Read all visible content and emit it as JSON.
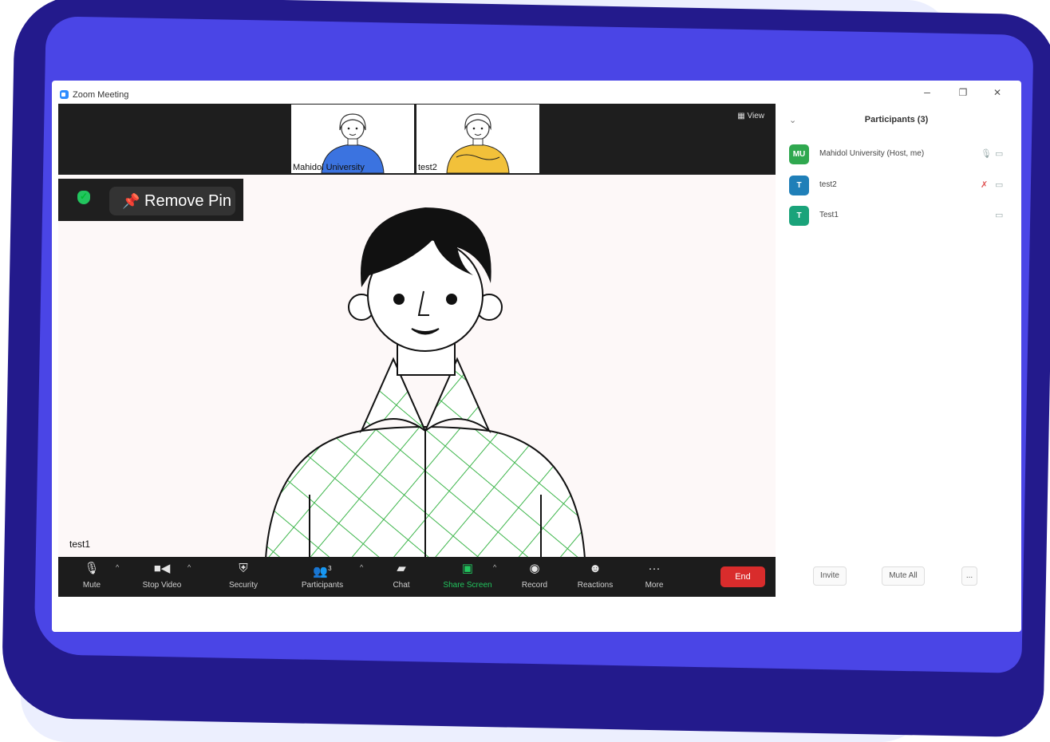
{
  "window": {
    "title": "Zoom Meeting",
    "minimize": "–",
    "restore": "❐",
    "close": "✕"
  },
  "strip": {
    "view_label": "View",
    "thumbs": [
      {
        "name": "Mahidol University",
        "shirt_color": "#3b73e0"
      },
      {
        "name": "test2",
        "shirt_color": "#f2c13a"
      }
    ]
  },
  "pin": {
    "label": "Remove Pin",
    "shield_color": "#22c55e"
  },
  "speaker": {
    "name": "test1",
    "shirt_check_color": "#3cb54a"
  },
  "toolbar": {
    "items": [
      {
        "label": "Mute",
        "icon": "mic-icon"
      },
      {
        "label": "Stop Video",
        "icon": "video-icon"
      },
      {
        "label": "Security",
        "icon": "shield-icon"
      },
      {
        "label": "Participants",
        "icon": "participants-icon",
        "count": "3"
      },
      {
        "label": "Chat",
        "icon": "chat-icon"
      },
      {
        "label": "Share Screen",
        "icon": "share-screen-icon"
      },
      {
        "label": "Record",
        "icon": "record-icon"
      },
      {
        "label": "Reactions",
        "icon": "reactions-icon"
      },
      {
        "label": "More",
        "icon": "more-icon"
      }
    ],
    "end_label": "End",
    "end_color": "#d92c2c"
  },
  "participants_panel": {
    "title": "Participants (3)",
    "people": [
      {
        "initials": "MU",
        "name": "Mahidol University (Host, me)",
        "avatar_color": "#2fa84f",
        "mic_muted": false
      },
      {
        "initials": "T",
        "name": "test2",
        "avatar_color": "#1f7fb8",
        "mic_muted": true
      },
      {
        "initials": "T",
        "name": "Test1",
        "avatar_color": "#1aa37a",
        "mic_muted": null
      }
    ],
    "invite_label": "Invite",
    "mute_all_label": "Mute All",
    "more_label": "..."
  },
  "colors": {
    "frame_outer": "#231a8c",
    "frame_inner": "#4a45e6"
  }
}
